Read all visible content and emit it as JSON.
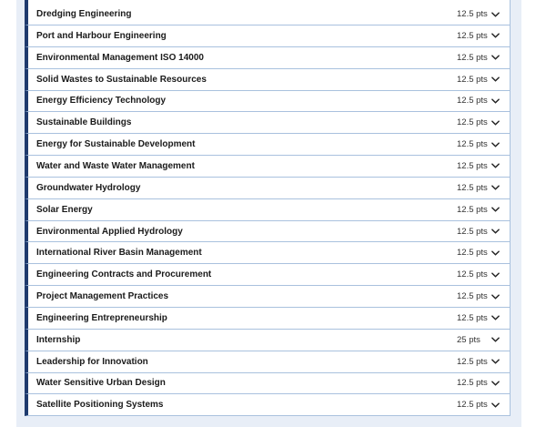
{
  "courses": [
    {
      "title": "Dredging Engineering",
      "points": "12.5 pts",
      "icon": "chevron-down-icon"
    },
    {
      "title": "Port and Harbour Engineering",
      "points": "12.5 pts",
      "icon": "chevron-down-icon"
    },
    {
      "title": "Environmental Management ISO 14000",
      "points": "12.5 pts",
      "icon": "chevron-down-icon"
    },
    {
      "title": "Solid Wastes to Sustainable Resources",
      "points": "12.5 pts",
      "icon": "chevron-down-icon"
    },
    {
      "title": "Energy Efficiency Technology",
      "points": "12.5 pts",
      "icon": "chevron-down-icon"
    },
    {
      "title": "Sustainable Buildings",
      "points": "12.5 pts",
      "icon": "chevron-down-icon"
    },
    {
      "title": "Energy for Sustainable Development",
      "points": "12.5 pts",
      "icon": "chevron-down-icon"
    },
    {
      "title": "Water and Waste Water Management",
      "points": "12.5 pts",
      "icon": "chevron-down-icon"
    },
    {
      "title": "Groundwater Hydrology",
      "points": "12.5 pts",
      "icon": "chevron-down-icon"
    },
    {
      "title": "Solar Energy",
      "points": "12.5 pts",
      "icon": "chevron-down-icon"
    },
    {
      "title": "Environmental Applied Hydrology",
      "points": "12.5 pts",
      "icon": "chevron-down-icon"
    },
    {
      "title": "International River Basin Management",
      "points": "12.5 pts",
      "icon": "chevron-down-icon"
    },
    {
      "title": "Engineering Contracts and Procurement",
      "points": "12.5 pts",
      "icon": "chevron-down-icon"
    },
    {
      "title": "Project Management Practices",
      "points": "12.5 pts",
      "icon": "chevron-down-icon"
    },
    {
      "title": "Engineering Entrepreneurship",
      "points": "12.5 pts",
      "icon": "chevron-down-icon"
    },
    {
      "title": "Internship",
      "points": "25 pts",
      "icon": "chevron-down-icon"
    },
    {
      "title": "Leadership for Innovation",
      "points": "12.5 pts",
      "icon": "chevron-down-icon"
    },
    {
      "title": "Water Sensitive Urban Design",
      "points": "12.5 pts",
      "icon": "chevron-down-icon"
    },
    {
      "title": "Satellite Positioning Systems",
      "points": "12.5 pts",
      "icon": "chevron-down-icon"
    }
  ],
  "colors": {
    "accent_bar": "#1e3a6e",
    "row_border": "#a9c1de",
    "panel_background": "#e8eef7"
  }
}
